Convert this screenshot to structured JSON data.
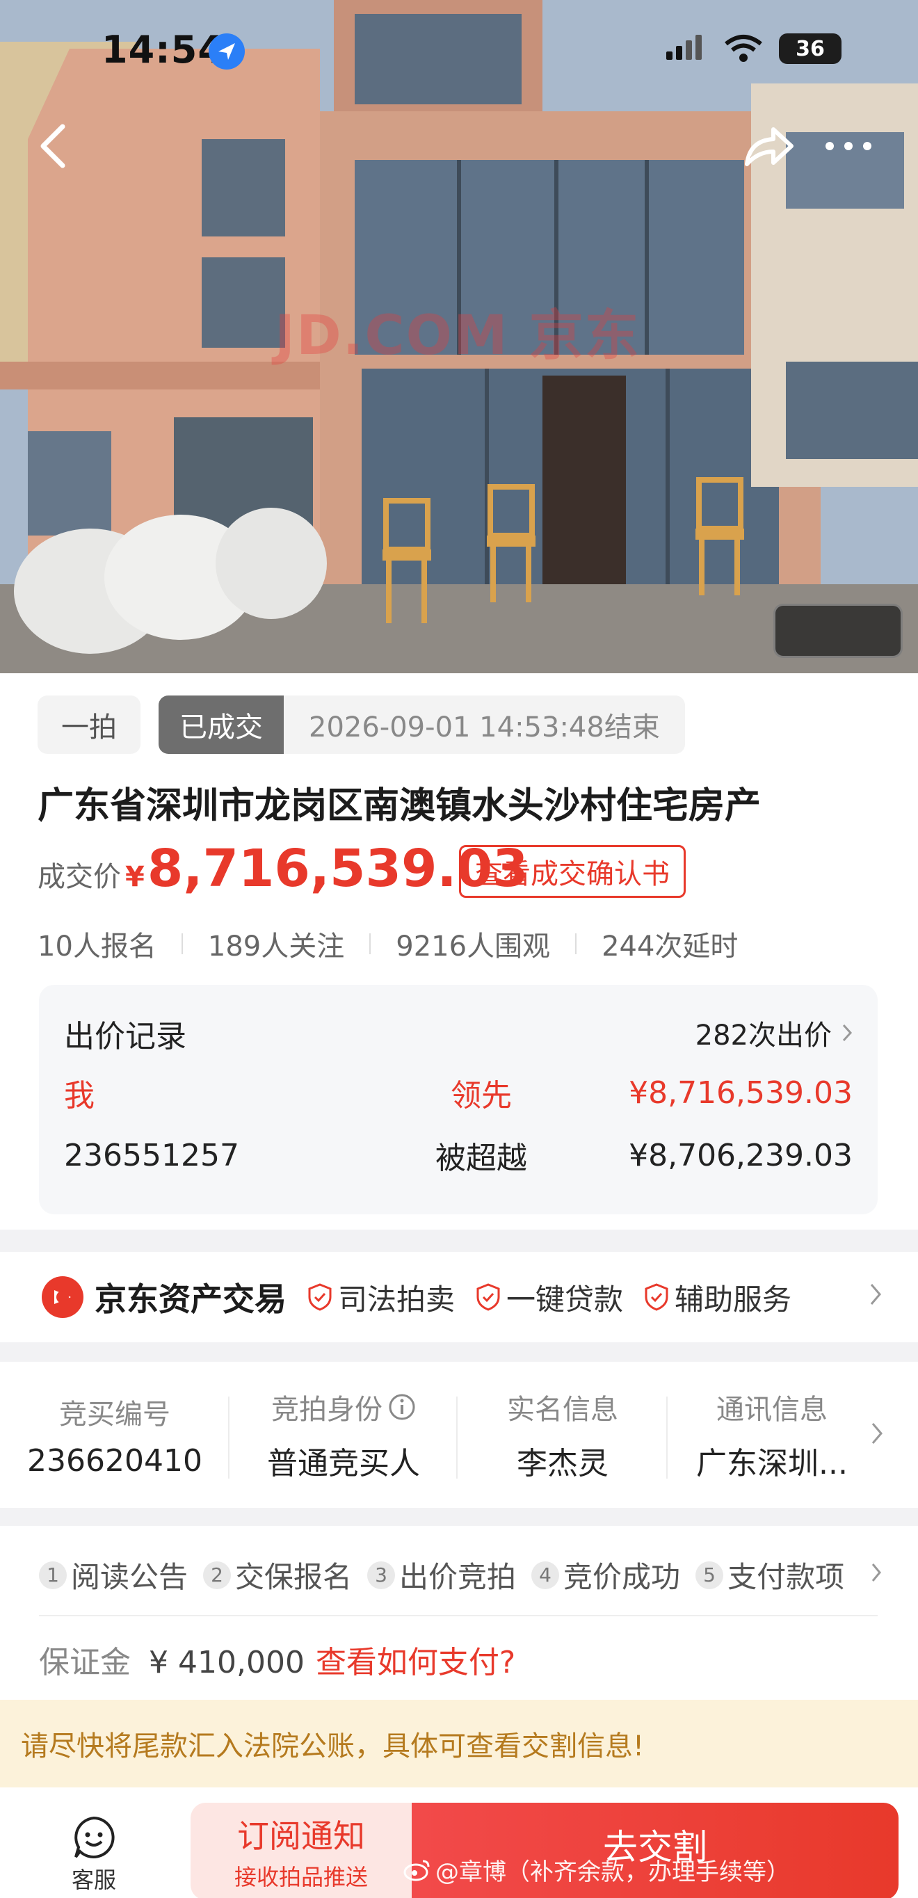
{
  "status_bar": {
    "time": "14:54",
    "battery": "36"
  },
  "hero": {
    "watermark": "JD.COM 京东"
  },
  "auction": {
    "tag_type": "一拍",
    "tag_status": "已成交",
    "end_time": "2026-09-01 14:53:48结束",
    "title": "广东省深圳市龙岗区南澳镇水头沙村住宅房产",
    "price_label": "成交价",
    "price_currency": "¥",
    "price_value": "8,716,539.03",
    "confirm_button": "查看成交确认书",
    "stats": [
      "10人报名",
      "189人关注",
      "9216人围观",
      "244次延时"
    ]
  },
  "bid_records": {
    "header": "出价记录",
    "count": "282次出价",
    "rows": [
      {
        "bidder": "我",
        "status": "领先",
        "amount": "¥8,716,539.03"
      },
      {
        "bidder": "236551257",
        "status": "被超越",
        "amount": "¥8,706,239.03"
      }
    ]
  },
  "platform": {
    "name": "京东资产交易",
    "perks": [
      "司法拍卖",
      "一键贷款",
      "辅助服务"
    ]
  },
  "bidder_info": [
    {
      "label": "竞买编号",
      "value": "236620410"
    },
    {
      "label": "竞拍身份",
      "value": "普通竞买人"
    },
    {
      "label": "实名信息",
      "value": "李杰灵"
    },
    {
      "label": "通讯信息",
      "value": "广东深圳..."
    }
  ],
  "steps": [
    "阅读公告",
    "交保报名",
    "出价竞拍",
    "竞价成功",
    "支付款项"
  ],
  "deposit": {
    "label": "保证金",
    "value": "¥ 410,000",
    "link": "查看如何支付?"
  },
  "notice": "请尽快将尾款汇入法院公账，具体可查看交割信息!",
  "bottom_bar": {
    "service_label": "客服",
    "subscribe_title": "订阅通知",
    "subscribe_sub": "接收拍品推送",
    "pay_label": "去交割",
    "watermark": "@章博（补齐余款，办理手续等）"
  },
  "colors": {
    "accent": "#e8392b",
    "notice_bg": "#fcf2da",
    "notice_text": "#b57a1e"
  }
}
